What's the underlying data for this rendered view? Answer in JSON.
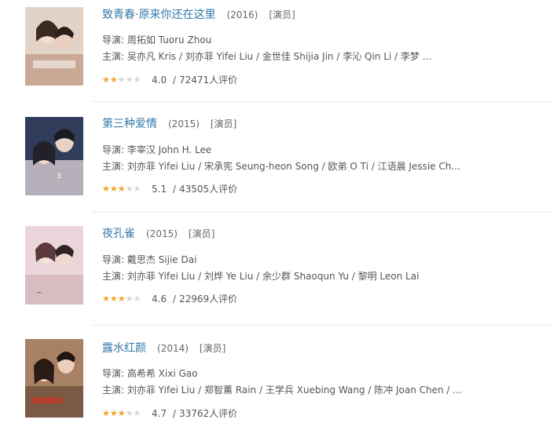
{
  "movies": [
    {
      "title": "致青春·原来你还在这里",
      "year": "(2016)",
      "role": "[演员]",
      "director": "导演: 周拓如 Tuoru Zhou",
      "cast": "主演: 吴亦凡 Kris / 刘亦菲 Yifei Liu / 金世佳 Shijia Jin / 李沁 Qin Li / 李梦 ...",
      "rating": "4.0",
      "rating_fraction": 0.4,
      "count": "72471人评价",
      "poster_colors": [
        "#d9c7b8",
        "#8a5a4a"
      ]
    },
    {
      "title": "第三种爱情",
      "year": "(2015)",
      "role": "[演员]",
      "director": "导演: 李宰汉 John H. Lee",
      "cast": "主演: 刘亦菲 Yifei Liu / 宋承宪 Seung-heon Song / 欧弟 O Ti / 江语晨 Jessie Ch...",
      "rating": "5.1",
      "rating_fraction": 0.5,
      "count": "43505人评价",
      "poster_colors": [
        "#3a4a6a",
        "#c9c2c8"
      ]
    },
    {
      "title": "夜孔雀",
      "year": "(2015)",
      "role": "[演员]",
      "director": "导演: 戴思杰 Sijie Dai",
      "cast": "主演: 刘亦菲 Yifei Liu / 刘烨 Ye Liu / 余少群 Shaoqun Yu / 黎明 Leon Lai",
      "rating": "4.6",
      "rating_fraction": 0.5,
      "count": "22969人评价",
      "poster_colors": [
        "#e6cfd4",
        "#a88890"
      ]
    },
    {
      "title": "露水红颜",
      "year": "(2014)",
      "role": "[演员]",
      "director": "导演: 高希希 Xixi Gao",
      "cast": "主演: 刘亦菲 Yifei Liu / 郑智薰 Rain / 王学兵 Xuebing Wang / 陈冲 Joan Chen / ...",
      "rating": "4.7",
      "rating_fraction": 0.5,
      "count": "33762人评价",
      "poster_colors": [
        "#b89070",
        "#5a4030"
      ]
    }
  ],
  "slash": "/",
  "accent_color": "#3377aa",
  "star_color": "#f6a623"
}
